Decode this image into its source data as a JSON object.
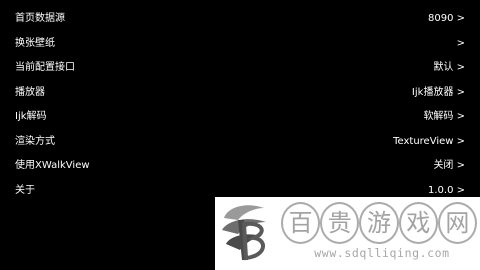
{
  "settings": [
    {
      "label": "首页数据源",
      "value": "8090 >"
    },
    {
      "label": "换张壁纸",
      "value": ">"
    },
    {
      "label": "当前配置接口",
      "value": "默认 >"
    },
    {
      "label": "播放器",
      "value": "Ijk播放器 >"
    },
    {
      "label": "Ijk解码",
      "value": "软解码 >"
    },
    {
      "label": "渲染方式",
      "value": "TextureView >"
    },
    {
      "label": "使用XWalkView",
      "value": "关闭 >"
    },
    {
      "label": "关于",
      "value": "1.0.0 >"
    }
  ],
  "watermark": {
    "chars": [
      "百",
      "贵",
      "游",
      "戏",
      "网"
    ],
    "url": "www.sdqlliqing.com",
    "colors": {
      "logo_dark": "#4a4a4a",
      "logo_light": "#9a9a9a",
      "text": "#a3a3a3"
    }
  }
}
